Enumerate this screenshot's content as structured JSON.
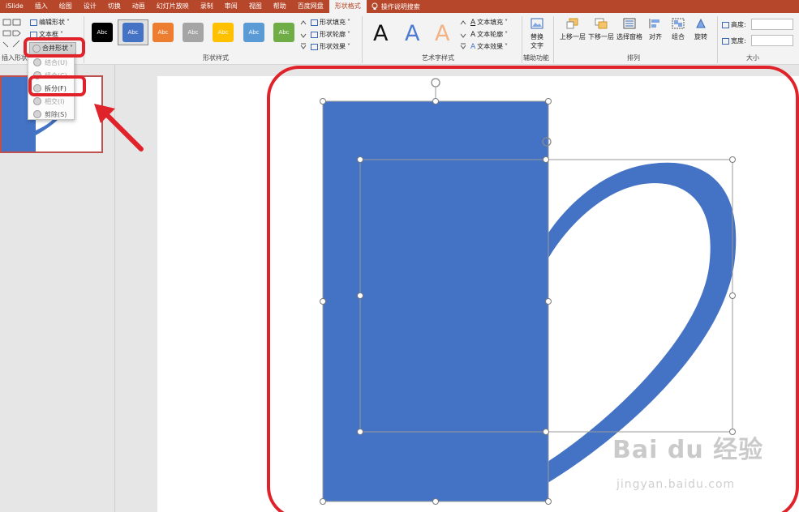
{
  "menu": {
    "tabs": [
      "iSlide",
      "插入",
      "绘图",
      "设计",
      "切换",
      "动画",
      "幻灯片放映",
      "录制",
      "审阅",
      "视图",
      "帮助",
      "百度网盘"
    ],
    "active_tab": "形状格式",
    "search_label": "操作说明搜索"
  },
  "ribbon": {
    "insert_shapes": {
      "edit_shape": "编辑形状",
      "text_box": "文本框",
      "merge_shapes": "合并形状",
      "group_label": "插入形状"
    },
    "shape_styles": {
      "swatch_label": "Abc",
      "swatches": [
        "#000000",
        "#4472c4",
        "#ed7d31",
        "#a5a5a5",
        "#ffc000",
        "#5b9bd5",
        "#70ad47"
      ],
      "fill": "形状填充",
      "outline": "形状轮廓",
      "effects": "形状效果",
      "group_label": "形状样式"
    },
    "wordart": {
      "letter": "A",
      "text_fill": "文本填充",
      "text_outline": "文本轮廓",
      "text_effects": "文本效果",
      "group_label": "艺术字样式"
    },
    "accessibility": {
      "alt_text_line1": "替换",
      "alt_text_line2": "文字",
      "group_label": "辅助功能"
    },
    "arrange": {
      "bring_forward": "上移一层",
      "send_backward": "下移一层",
      "selection_pane": "选择窗格",
      "align": "对齐",
      "group": "组合",
      "rotate": "旋转",
      "group_label": "排列"
    },
    "size": {
      "height_label": "高度:",
      "width_label": "宽度:",
      "group_label": "大小"
    }
  },
  "merge_dropdown": {
    "items": [
      "结合(U)",
      "组合(C)",
      "拆分(F)",
      "相交(I)",
      "剪除(S)"
    ]
  },
  "watermark": {
    "text": "Bai du 经验",
    "url": "jingyan.baidu.com"
  },
  "colors": {
    "accent": "#b7472a",
    "shape_blue": "#4472c4",
    "annotation_red": "#e0232a"
  }
}
